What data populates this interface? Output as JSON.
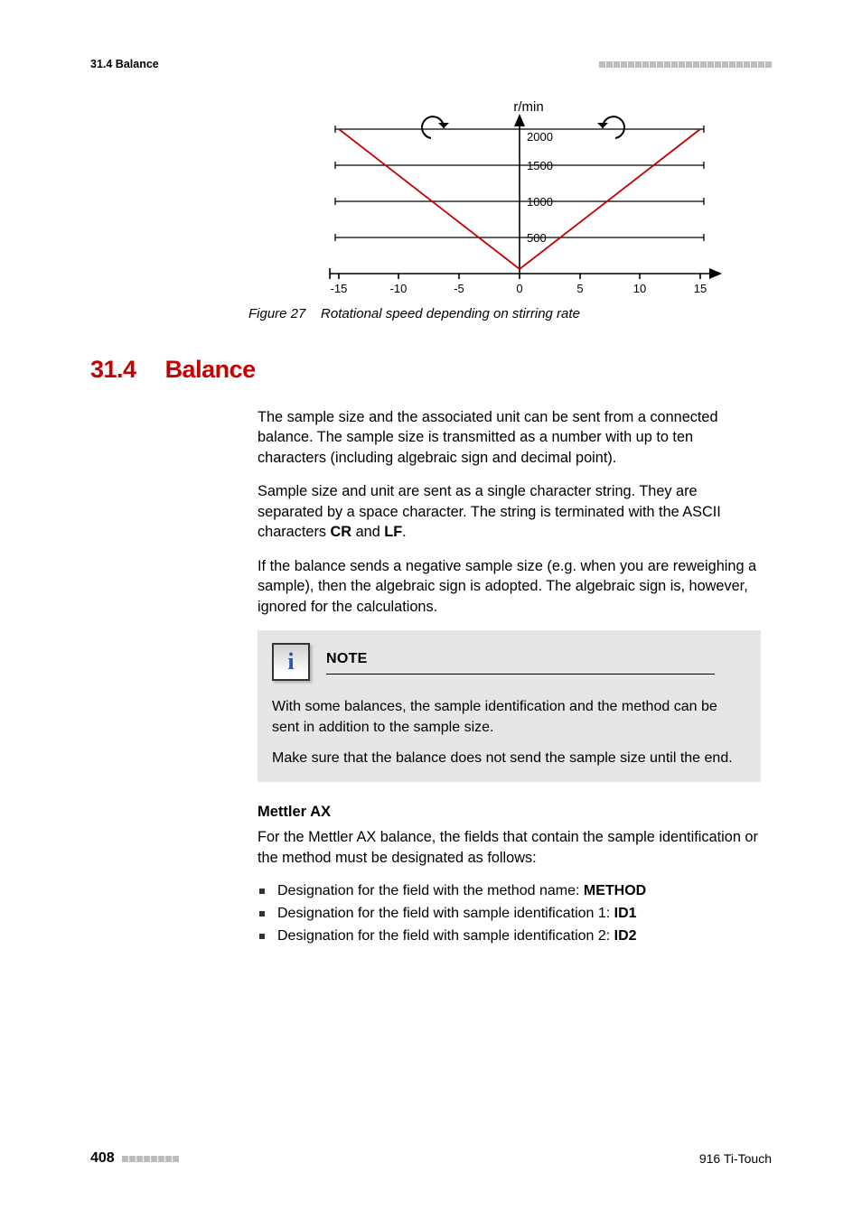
{
  "header": {
    "left": "31.4 Balance"
  },
  "chart_data": {
    "type": "line",
    "title": "r/min",
    "xlabel": "",
    "ylabel": "",
    "xlim": [
      -15,
      15
    ],
    "ylim": [
      0,
      2000
    ],
    "x_ticks": [
      -15,
      -10,
      -5,
      0,
      5,
      10,
      15
    ],
    "y_ticks": [
      500,
      1000,
      1500,
      2000
    ],
    "series": [
      {
        "name": "left",
        "color": "#c40000",
        "x": [
          -15,
          0
        ],
        "y": [
          2000,
          60
        ]
      },
      {
        "name": "right",
        "color": "#c40000",
        "x": [
          0,
          15
        ],
        "y": [
          60,
          2000
        ]
      }
    ],
    "annotations": {
      "left_arrow": "counter-clockwise",
      "right_arrow": "clockwise"
    }
  },
  "caption": {
    "figure_num": "Figure 27",
    "figure_text": "Rotational speed depending on stirring rate"
  },
  "section": {
    "number": "31.4",
    "title": "Balance"
  },
  "para1a": "The sample size and the associated unit can be sent from a connected balance. The sample size is transmitted as a number with up to ten characters (including algebraic sign and decimal point).",
  "para2a": "Sample size and unit are sent as a single character string. They are separated by a space character. The string is terminated with the ASCII characters ",
  "para2b": "CR",
  "para2c": " and ",
  "para2d": "LF",
  "para2e": ".",
  "para3": "If the balance sends a negative sample size (e.g. when you are reweighing a sample), then the algebraic sign is adopted. The algebraic sign is, however, ignored for the calculations.",
  "note": {
    "label": "NOTE",
    "p1": "With some balances, the sample identification and the method can be sent in addition to the sample size.",
    "p2": "Make sure that the balance does not send the sample size until the end."
  },
  "subhead": "Mettler AX",
  "subpara": "For the Mettler AX balance, the fields that contain the sample identification or the method must be designated as follows:",
  "bullets": [
    {
      "pre": "Designation for the field with the method name: ",
      "bold": "METHOD"
    },
    {
      "pre": "Designation for the field with sample identification 1: ",
      "bold": "ID1"
    },
    {
      "pre": "Designation for the field with sample identification 2: ",
      "bold": "ID2"
    }
  ],
  "footer": {
    "page_num": "408",
    "right": "916 Ti-Touch"
  },
  "info_glyph": "i"
}
